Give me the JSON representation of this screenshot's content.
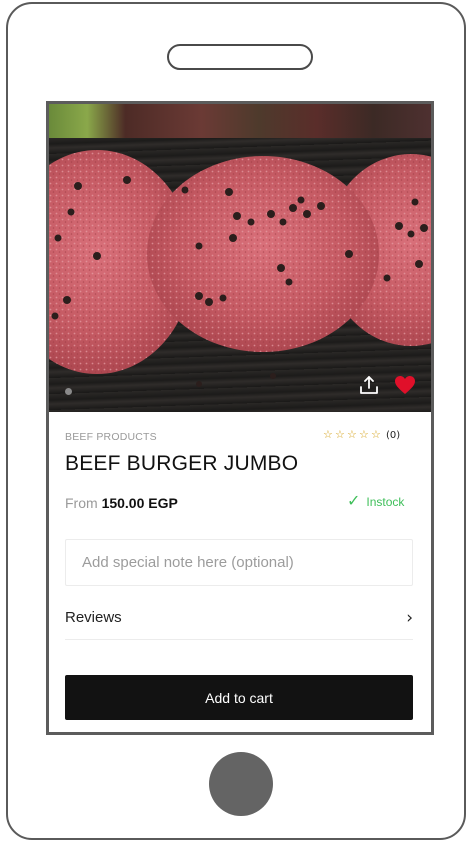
{
  "product": {
    "image_alt": "Beef burger patties with peppercorns",
    "category": "BEEF PRODUCTS",
    "rating": {
      "stars_filled": 0,
      "stars_total": 5,
      "count": "(0)"
    },
    "title": "BEEF BURGER JUMBO",
    "price_prefix": "From",
    "price": "150.00 EGP",
    "stock_status": "Instock"
  },
  "note": {
    "placeholder": "Add special note here (optional)",
    "value": ""
  },
  "reviews": {
    "label": "Reviews",
    "chevron": "›"
  },
  "actions": {
    "add_to_cart": "Add to cart"
  },
  "icons": {
    "share": "share-icon",
    "favorite": "heart-icon",
    "check": "check-icon",
    "star": "star-outline-icon",
    "chevron": "chevron-right-icon"
  },
  "colors": {
    "accent_stock": "#3fbf5a",
    "favorite": "#e0102a",
    "star": "#d4a017",
    "cart_button": "#121212"
  },
  "carousel": {
    "slides": 1,
    "active_index": 0
  }
}
